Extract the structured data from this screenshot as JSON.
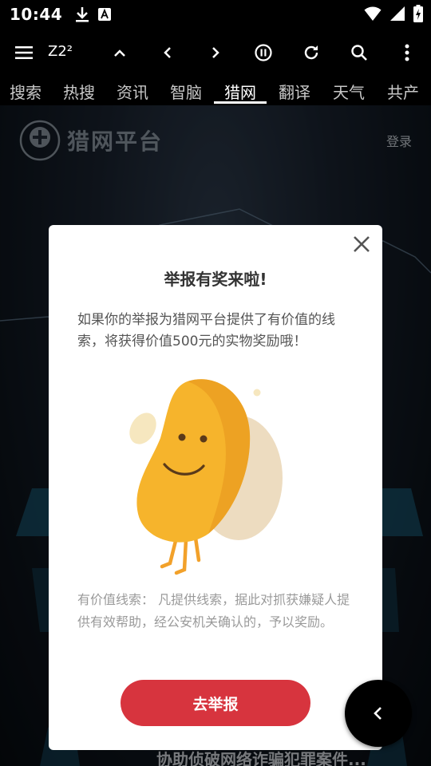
{
  "status_bar": {
    "time": "10:44"
  },
  "toolbar": {
    "title": "Z2²"
  },
  "tabs": [
    {
      "label": "搜索"
    },
    {
      "label": "热搜"
    },
    {
      "label": "资讯"
    },
    {
      "label": "智脑"
    },
    {
      "label": "猎网",
      "active": true
    },
    {
      "label": "翻译"
    },
    {
      "label": "天气"
    },
    {
      "label": "共产"
    }
  ],
  "background": {
    "logo_text": "猎网平台",
    "login": "登录",
    "bottom_text": "协助侦破网络诈骗犯罪案件..."
  },
  "dialog": {
    "title": "举报有奖来啦!",
    "description": "如果你的举报为猎网平台提供了有价值的线索，将获得价值500元的实物奖励哦！",
    "note": "有价值线索：   凡提供线索，据此对抓获嫌疑人提供有效帮助，经公安机关确认的，予以奖励。",
    "button": "去举报"
  },
  "colors": {
    "accent": "#d7343e",
    "mascot": "#f7b32b",
    "overlay": "rgba(0,0,0,0.45)"
  }
}
